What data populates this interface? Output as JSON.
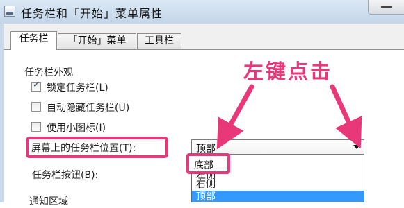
{
  "window": {
    "title": "任务栏和「开始」菜单属性"
  },
  "tabs": [
    {
      "label": "任务栏",
      "active": true
    },
    {
      "label": "「开始」菜单",
      "active": false
    },
    {
      "label": "工具栏",
      "active": false
    }
  ],
  "appearance": {
    "group_title": "任务栏外观",
    "lock_taskbar": {
      "label": "锁定任务栏(L)",
      "checked": true
    },
    "auto_hide": {
      "label": "自动隐藏任务栏(U)",
      "checked": false
    },
    "small_icons": {
      "label": "使用小图标(I)",
      "checked": false
    },
    "position_label": "屏幕上的任务栏位置(T):",
    "position_value": "顶部",
    "position_options": [
      {
        "label": "底部",
        "highlighted": false
      },
      {
        "label": "左侧",
        "highlighted": false
      },
      {
        "label": "右侧",
        "highlighted": false
      },
      {
        "label": "顶部",
        "highlighted": true
      }
    ],
    "buttons_label": "任务栏按钮(B):"
  },
  "notification": {
    "group_title": "通知区域"
  },
  "annotation": {
    "text": "左键点击",
    "color": "#e8387a"
  }
}
